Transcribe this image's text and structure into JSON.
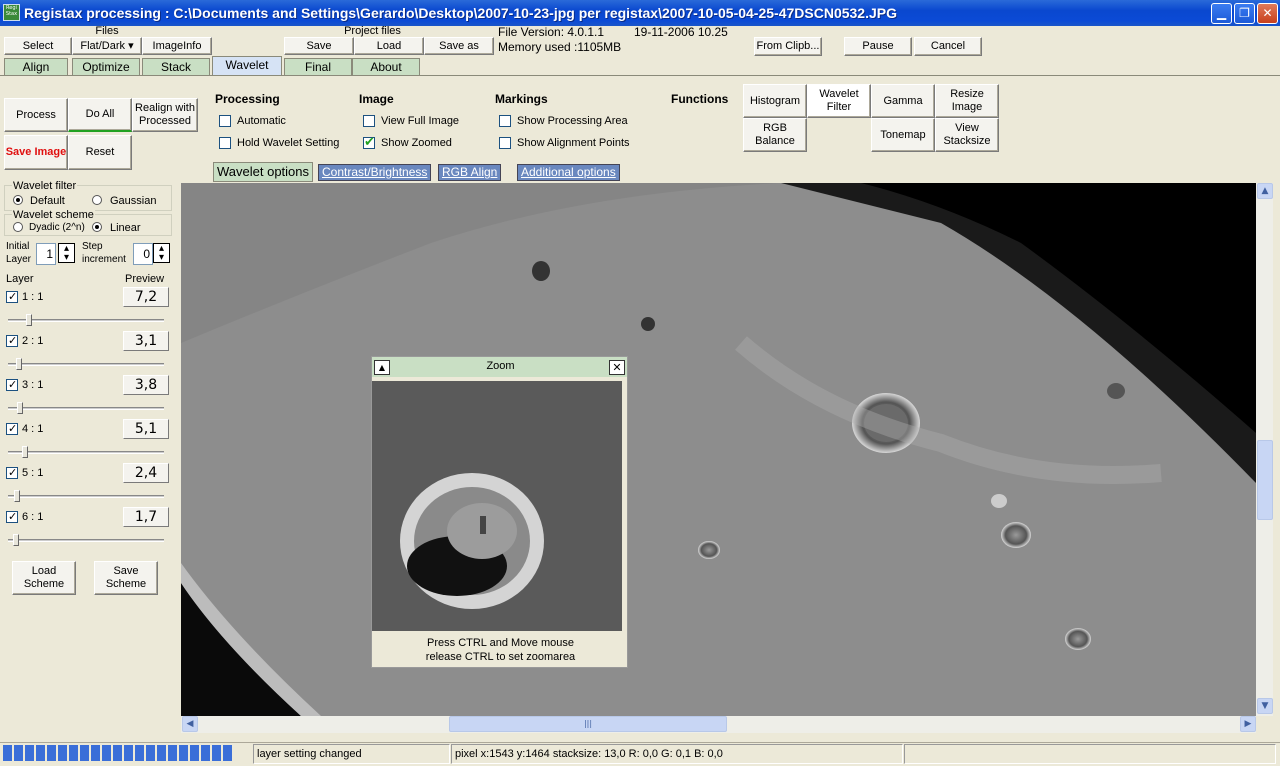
{
  "window": {
    "title": "Registax processing : C:\\Documents and Settings\\Gerardo\\Desktop\\2007-10-23-jpg per registax\\2007-10-05-04-25-47DSCN0532.JPG",
    "icon_text": "Regi Stax"
  },
  "toolbar": {
    "files_label": "Files",
    "select": "Select",
    "flatdark": "Flat/Dark ▾",
    "imageinfo": "ImageInfo",
    "project_files_label": "Project files",
    "save": "Save",
    "load": "Load",
    "save_as": "Save as",
    "file_version": "File Version: 4.0.1.1",
    "file_date": "19-11-2006 10.25",
    "memory_used": "Memory used :1105MB",
    "from_clipboard": "From Clipb...",
    "pause": "Pause",
    "cancel": "Cancel"
  },
  "tabs": [
    "Align",
    "Optimize",
    "Stack",
    "Wavelet",
    "Final",
    "About"
  ],
  "active_tab": "Wavelet",
  "actions": {
    "process": "Process",
    "do_all": "Do All",
    "realign": "Realign with Processed",
    "save_image": "Save Image",
    "reset": "Reset"
  },
  "processing": {
    "header": "Processing",
    "automatic": "Automatic",
    "hold": "Hold Wavelet Setting"
  },
  "image": {
    "header": "Image",
    "view_full": "View Full Image",
    "show_zoomed": "Show Zoomed"
  },
  "markings": {
    "header": "Markings",
    "show_area": "Show Processing Area",
    "show_points": "Show Alignment Points"
  },
  "functions": {
    "header": "Functions",
    "histogram": "Histogram",
    "wavelet_filter": "Wavelet Filter",
    "gamma": "Gamma",
    "resize": "Resize Image",
    "rgb_balance": "RGB Balance",
    "tonemap": "Tonemap",
    "view_stacksize": "View Stacksize"
  },
  "subtabs": [
    "Wavelet options",
    "Contrast/Brightness",
    "RGB Align",
    "Additional options"
  ],
  "wavelet_panel": {
    "filter_label": "Wavelet filter",
    "default": "Default",
    "gaussian": "Gaussian",
    "scheme_label": "Wavelet scheme",
    "dyadic": "Dyadic (2^n)",
    "linear": "Linear",
    "initial_layer_label": "Initial Layer",
    "initial_layer": "1",
    "step_label": "Step increment",
    "step": "0",
    "layer_label": "Layer",
    "preview_label": "Preview",
    "layers": [
      {
        "name": "1 : 1",
        "value": "7,2",
        "level": 0.12
      },
      {
        "name": "2 : 1",
        "value": "3,1",
        "level": 0.05
      },
      {
        "name": "3 : 1",
        "value": "3,8",
        "level": 0.06
      },
      {
        "name": "4 : 1",
        "value": "5,1",
        "level": 0.09
      },
      {
        "name": "5 : 1",
        "value": "2,4",
        "level": 0.04
      },
      {
        "name": "6 : 1",
        "value": "1,7",
        "level": 0.03
      }
    ],
    "load_scheme": "Load Scheme",
    "save_scheme": "Save Scheme"
  },
  "zoom": {
    "title": "Zoom",
    "hint1": "Press CTRL and Move mouse",
    "hint2": "release CTRL to set zoomarea"
  },
  "status": {
    "message": "layer setting changed",
    "pixel_info": "pixel x:1543 y:1464 stacksize: 13,0 R: 0,0 G: 0,1 B: 0,0"
  }
}
